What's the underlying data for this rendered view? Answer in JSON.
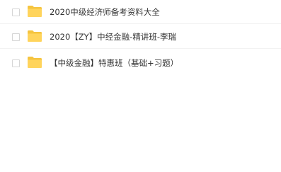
{
  "files": [
    {
      "name": "2020中级经济师备考资料大全",
      "icon": "folder-icon"
    },
    {
      "name": "2020【ZY】中经金融-精讲班-李瑞",
      "icon": "folder-icon"
    },
    {
      "name": "【中级金融】特惠班（基础+习题）",
      "icon": "folder-icon"
    }
  ],
  "colors": {
    "folder": "#FFD45C",
    "folder_tab": "#F5C43F",
    "text": "#333333"
  }
}
